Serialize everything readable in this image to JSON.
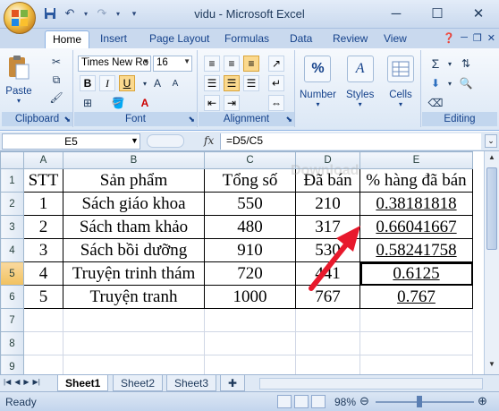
{
  "window": {
    "title": "vidu - Microsoft Excel",
    "minimize": "─",
    "maximize": "☐",
    "close": "✕"
  },
  "tabs": [
    "Home",
    "Insert",
    "Page Layout",
    "Formulas",
    "Data",
    "Review",
    "View"
  ],
  "ribbon": {
    "clipboard": {
      "label": "Clipboard",
      "paste": "Paste"
    },
    "font": {
      "label": "Font",
      "font_name": "Times New Ro",
      "font_size": "16",
      "bold": "B",
      "italic": "I",
      "underline": "U",
      "font_color": "A"
    },
    "alignment": {
      "label": "Alignment"
    },
    "number": {
      "label": "Number",
      "button": "Number",
      "icon": "%"
    },
    "styles": {
      "button": "Styles"
    },
    "cells": {
      "button": "Cells"
    },
    "editing": {
      "label": "Editing"
    }
  },
  "formula_bar": {
    "name_box": "E5",
    "fx": "fx",
    "formula": "=D5/C5"
  },
  "columns": [
    "A",
    "B",
    "C",
    "D",
    "E"
  ],
  "rows": [
    {
      "num": "1",
      "cells": [
        "STT",
        "Sản phẩm",
        "Tổng số",
        "Đã bán",
        "% hàng đã bán"
      ]
    },
    {
      "num": "2",
      "cells": [
        "1",
        "Sách giáo khoa",
        "550",
        "210",
        "0.38181818"
      ]
    },
    {
      "num": "3",
      "cells": [
        "2",
        "Sách tham khảo",
        "480",
        "317",
        "0.66041667"
      ]
    },
    {
      "num": "4",
      "cells": [
        "3",
        "Sách bồi dưỡng",
        "910",
        "530",
        "0.58241758"
      ]
    },
    {
      "num": "5",
      "cells": [
        "4",
        "Truyện trinh thám",
        "720",
        "441",
        "0.6125"
      ]
    },
    {
      "num": "6",
      "cells": [
        "5",
        "Truyện tranh",
        "1000",
        "767",
        "0.767"
      ]
    },
    {
      "num": "7",
      "cells": [
        "",
        "",
        "",
        "",
        ""
      ]
    },
    {
      "num": "8",
      "cells": [
        "",
        "",
        "",
        "",
        ""
      ]
    },
    {
      "num": "9",
      "cells": [
        "",
        "",
        "",
        "",
        ""
      ]
    }
  ],
  "active_cell": "E5",
  "sheets": [
    "Sheet1",
    "Sheet2",
    "Sheet3"
  ],
  "active_sheet": "Sheet1",
  "status": {
    "text": "Ready",
    "zoom": "98%",
    "zoom_out": "⊖",
    "zoom_in": "⊕"
  },
  "watermark": "Download",
  "colors": {
    "accent": "#15428b",
    "arrow": "#e8192c",
    "selected_header": "#f1c15f"
  }
}
